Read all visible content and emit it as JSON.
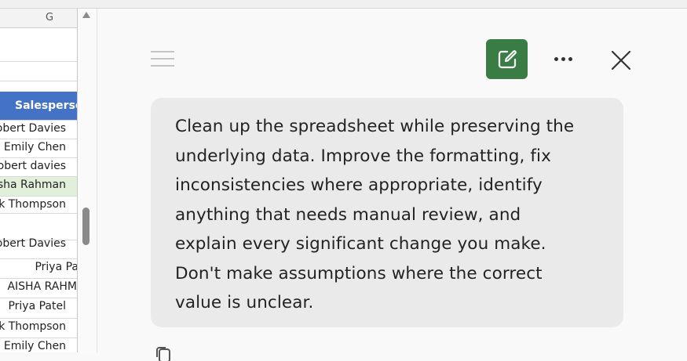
{
  "spreadsheet": {
    "column_letter": "G",
    "header": "Salesperson",
    "rows": [
      {
        "text": "Robert Davies",
        "align": "left",
        "highlight": false
      },
      {
        "text": "Emily Chen",
        "align": "left",
        "highlight": false
      },
      {
        "text": "Robert davies",
        "align": "left",
        "highlight": false
      },
      {
        "text": "Aisha Rahman",
        "align": "left",
        "highlight": true
      },
      {
        "text": "Mark Thompson",
        "align": "left",
        "highlight": false
      },
      {
        "text": "",
        "align": "left",
        "highlight": false
      },
      {
        "text": "Robert Davies",
        "align": "left",
        "highlight": false
      },
      {
        "text": "Priya Patel",
        "align": "right",
        "highlight": false
      },
      {
        "text": "AISHA RAHMAN",
        "align": "right",
        "highlight": false
      },
      {
        "text": "Priya Patel",
        "align": "left",
        "highlight": false
      },
      {
        "text": "Mark Thompson",
        "align": "left",
        "highlight": false
      },
      {
        "text": "Emily Chen",
        "align": "left",
        "highlight": false
      }
    ]
  },
  "chat": {
    "icons": {
      "menu": "menu-icon",
      "new_chat": "new-chat-icon",
      "more": "more-options-icon",
      "close": "close-icon",
      "copy": "copy-icon"
    },
    "accent_color": "#3a7d44",
    "message_lines": [
      "Clean up the spreadsheet while preserving the",
      "underlying data. Improve the formatting, fix",
      "inconsistencies where appropriate, identify",
      "anything that needs manual review, and",
      "explain every significant change you make.",
      "Don't make assumptions where the correct",
      "value is unclear."
    ]
  }
}
